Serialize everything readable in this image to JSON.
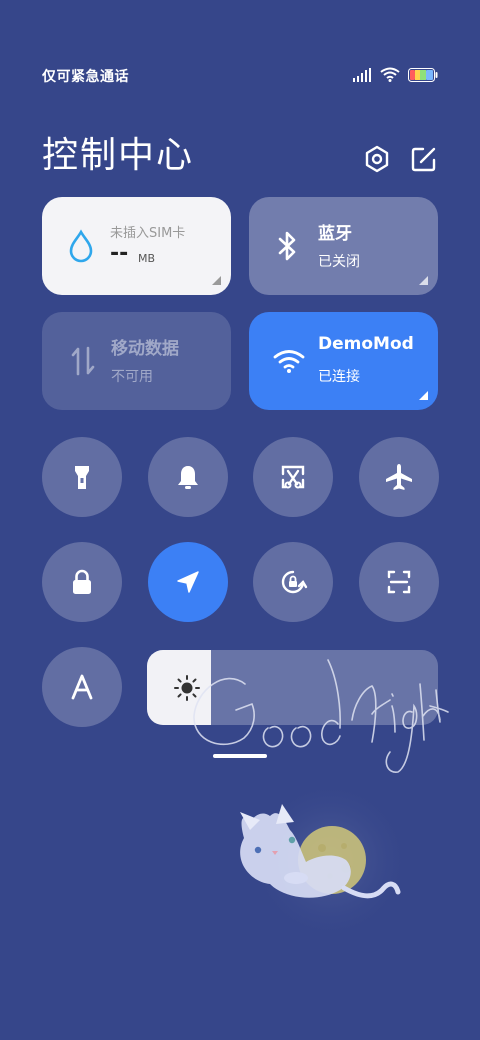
{
  "status_bar": {
    "carrier_text": "仅可紧急通话",
    "signal_icon": "signal-icon",
    "wifi_icon": "wifi-icon",
    "battery_icon": "battery-icon"
  },
  "header": {
    "title": "控制中心",
    "settings_icon": "settings-hexagon-icon",
    "edit_icon": "edit-icon"
  },
  "tiles": {
    "data_usage": {
      "label": "未插入SIM卡",
      "value": "--",
      "unit": "MB",
      "icon": "water-drop-icon"
    },
    "bluetooth": {
      "label": "蓝牙",
      "status": "已关闭",
      "icon": "bluetooth-icon"
    },
    "mobile_data": {
      "label": "移动数据",
      "status": "不可用",
      "icon": "data-arrows-icon"
    },
    "wifi": {
      "label": "DemoMod",
      "status": "已连接",
      "icon": "wifi-icon"
    }
  },
  "toggles": [
    {
      "name": "flashlight",
      "icon": "flashlight-icon",
      "active": false
    },
    {
      "name": "ringer",
      "icon": "bell-icon",
      "active": false
    },
    {
      "name": "screenshot",
      "icon": "scissors-screenshot-icon",
      "active": false
    },
    {
      "name": "airplane",
      "icon": "airplane-icon",
      "active": false
    },
    {
      "name": "lock",
      "icon": "lock-icon",
      "active": false
    },
    {
      "name": "location",
      "icon": "location-arrow-icon",
      "active": true
    },
    {
      "name": "auto-rotate",
      "icon": "rotate-lock-icon",
      "active": false
    },
    {
      "name": "scanner",
      "icon": "scan-icon",
      "active": false
    },
    {
      "name": "font-size",
      "icon": "font-a-icon",
      "active": false
    }
  ],
  "brightness": {
    "level": 0.22,
    "icon": "sun-icon"
  },
  "wallpaper": {
    "handwriting": "Good night",
    "illustration": "cat-with-moon"
  },
  "colors": {
    "background": "#36468a",
    "accent": "#3c80f5"
  }
}
